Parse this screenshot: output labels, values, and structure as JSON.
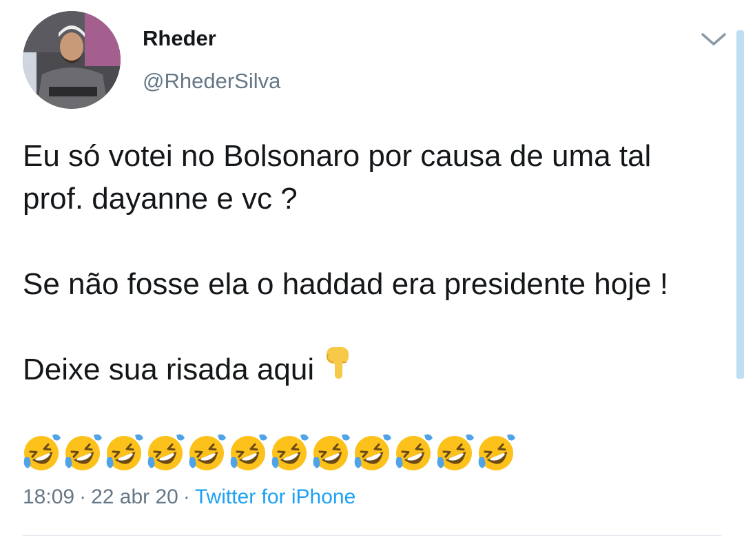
{
  "user": {
    "display_name": "Rheder",
    "handle": "@RhederSilva"
  },
  "tweet": {
    "line1": "Eu só votei no Bolsonaro por causa de uma tal",
    "line2": "prof. dayanne e vc ?",
    "line3": "Se não fosse ela o haddad era presidente hoje !",
    "line4": "Deixe sua risada aqui",
    "line4_emoji": "backhand-index-pointing-down-icon",
    "laugh_emoji": "rolling-on-the-floor-laughing-icon",
    "laugh_emoji_count": 12
  },
  "meta": {
    "time": "18:09",
    "separator": "·",
    "date": "22 abr 20",
    "source": "Twitter for iPhone"
  },
  "colors": {
    "text": "#14171a",
    "secondary": "#657786",
    "link": "#1da1f2",
    "divider": "#e1e8ed",
    "scrollbar": "#bcdff3"
  }
}
